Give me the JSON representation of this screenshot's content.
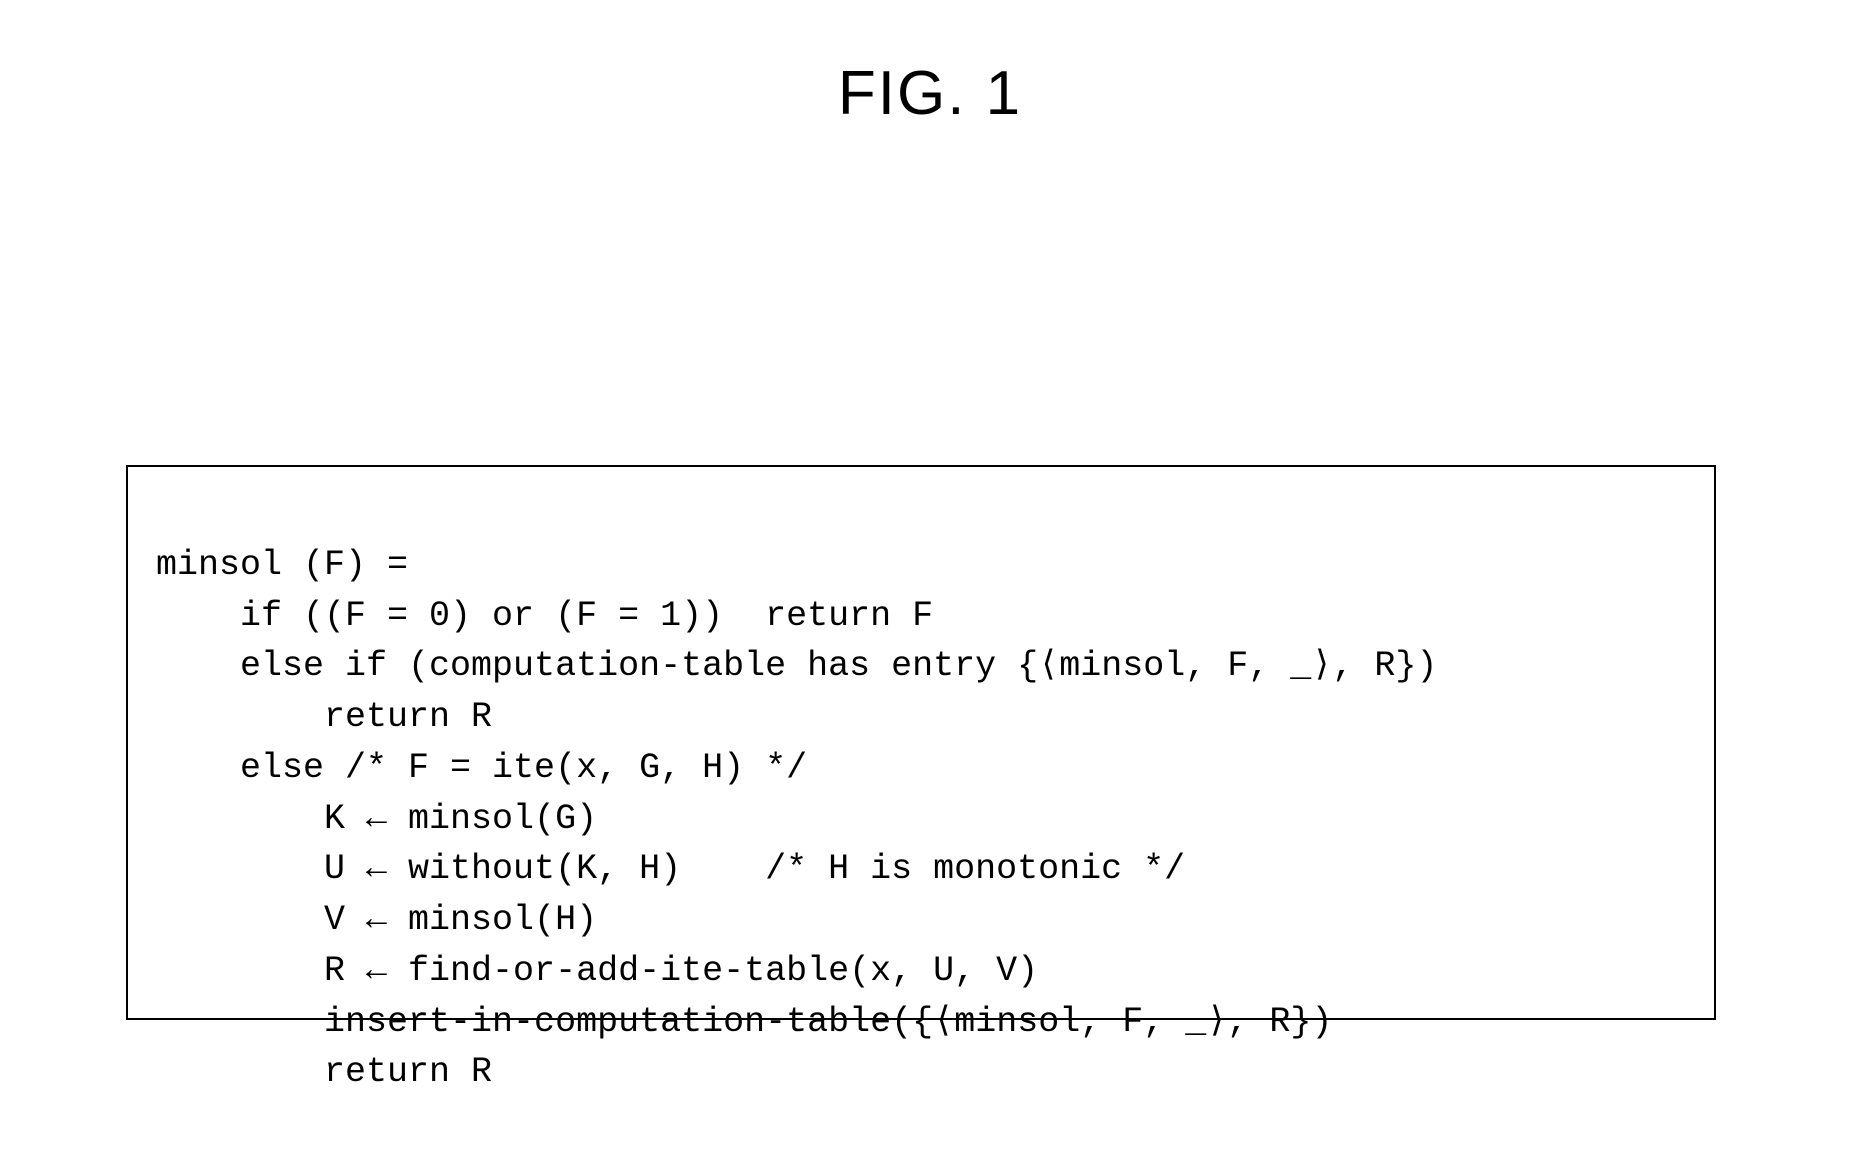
{
  "figure": {
    "title": "FIG. 1"
  },
  "algorithm": {
    "lines": [
      "minsol (F) =",
      "    if ((F = 0) or (F = 1))  return F",
      "    else if (computation-table has entry {⟨minsol, F, _⟩, R})",
      "        return R",
      "    else /* F = ite(x, G, H) */",
      "        K ← minsol(G)",
      "        U ← without(K, H)    /* H is monotonic */",
      "        V ← minsol(H)",
      "        R ← find-or-add-ite-table(x, U, V)",
      "        insert-in-computation-table({⟨minsol, F, _⟩, R})",
      "        return R"
    ]
  }
}
